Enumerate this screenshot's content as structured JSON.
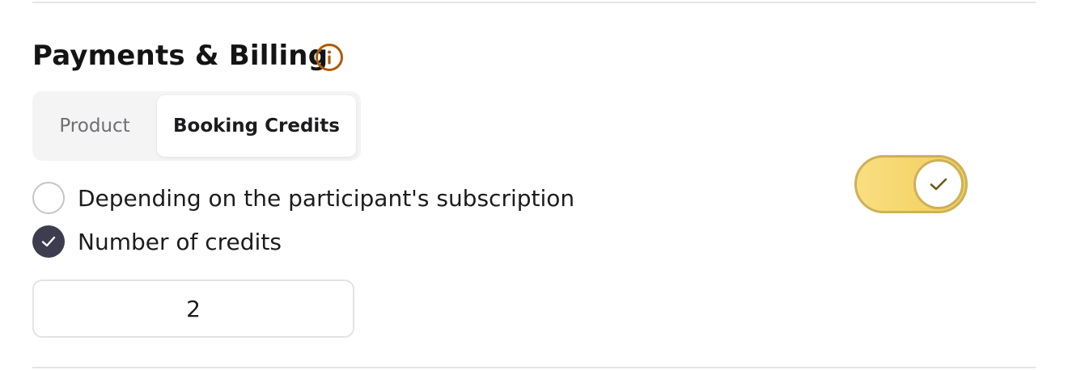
{
  "section": {
    "title": "Payments & Billing",
    "info_icon": "info-circle-icon"
  },
  "tabs": [
    {
      "label": "Product",
      "selected": false
    },
    {
      "label": "Booking Credits",
      "selected": true
    }
  ],
  "options": [
    {
      "label": "Depending on the participant's subscription",
      "checked": false
    },
    {
      "label": "Number of credits",
      "checked": true
    }
  ],
  "credits_input": {
    "value": "2"
  },
  "toggle": {
    "on": true,
    "icon": "check-icon"
  },
  "colors": {
    "accent_orange": "#b05a00",
    "toggle_yellow": "#f5d56a",
    "toggle_border": "#cdb05a",
    "radio_checked": "#3d3d4f"
  }
}
